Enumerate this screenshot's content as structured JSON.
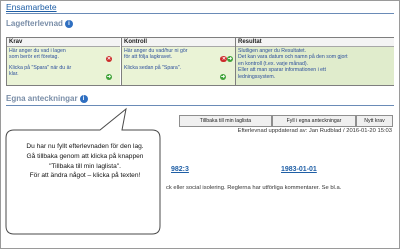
{
  "header": {
    "title": "Ensamarbete"
  },
  "lagefterlevnad": {
    "title": "Lagefterlevnad",
    "columns": [
      {
        "head": "Krav",
        "lines": [
          "Här anger du vad i lagen",
          "som berör ert företag.",
          "",
          "Klicka på \"Spara\" när du är",
          "klar."
        ]
      },
      {
        "head": "Kontroll",
        "lines": [
          "Här anger du vad/hur ni gör",
          "för att följa lagkravet.",
          "",
          "Klicka sedan på \"Spara\"."
        ]
      },
      {
        "head": "Resultat",
        "lines": [
          "Slutligen anger du Resultatet.",
          "Det kan vara datum och namn på den som gjort",
          "en kontroll (t.ex. varje månad).",
          "Eller att man sparar informationen i ett",
          "ledningssystem."
        ]
      }
    ],
    "delete_label": "✕",
    "save_label": "➜"
  },
  "notes": {
    "title": "Egna anteckningar"
  },
  "toolbar": {
    "back_to_list": "Tillbaka till min laglista",
    "fill_notes": "Fyll i egna anteckningar",
    "new_req": "Nytt krav"
  },
  "status": {
    "updated": "Efterlevnad uppdaterad av: Jan Rudblad / 2016-01-20 15:03"
  },
  "years": [
    "982:3",
    "1983-01-01"
  ],
  "row_text": "ck eller social isolering. Reglerna har utförliga kommentarer. Se bl.a.",
  "callout": {
    "lines": [
      "Du har nu fyllt efterlevnaden för den lag.",
      "Gå tillbaka genom att klicka på knappen",
      "\"Tillbaka till min laglista\".",
      "För att ändra något – klicka på texten!"
    ]
  },
  "colors": {
    "link": "#1f5fa6",
    "cell_bg": "#eaf3d6",
    "info_icon": "#2f6fc1"
  }
}
